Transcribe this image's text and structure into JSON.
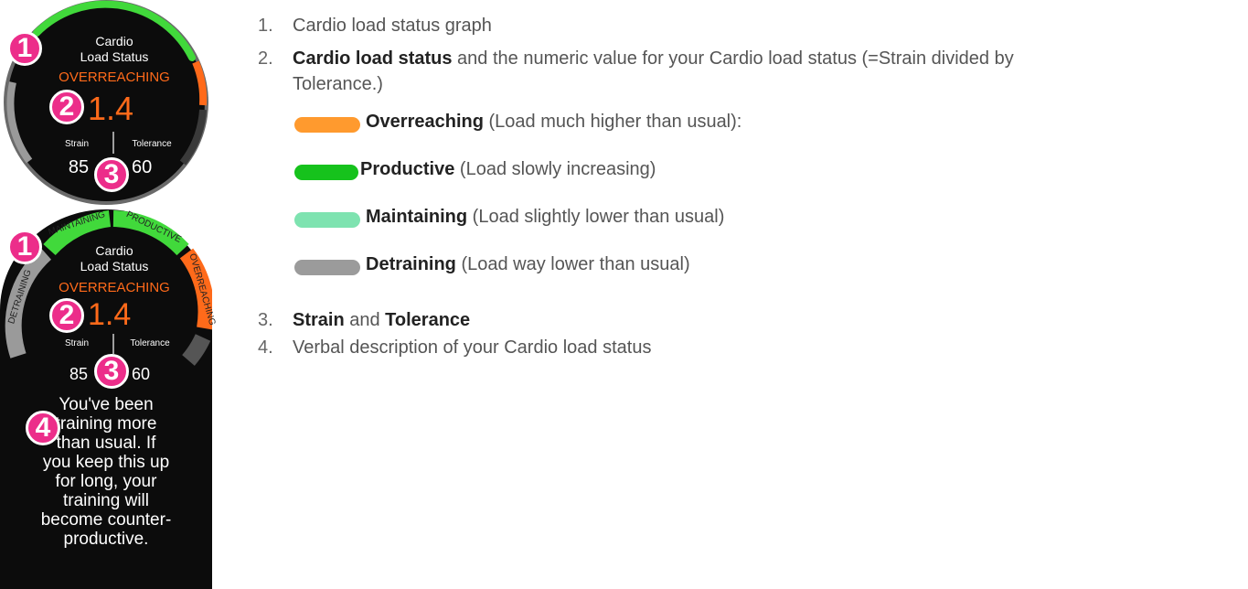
{
  "watch1": {
    "title_line1": "Cardio",
    "title_line2": "Load Status",
    "status": "OVERREACHING",
    "value": "1.4",
    "strain_label": "Strain",
    "tolerance_label": "Tolerance",
    "strain_value": "85",
    "tolerance_value": "60",
    "markers": [
      "1",
      "2",
      "3"
    ]
  },
  "watch2": {
    "title_line1": "Cardio",
    "title_line2": "Load Status",
    "status": "OVERREACHING",
    "value": "1.4",
    "strain_label": "Strain",
    "tolerance_label": "Tolerance",
    "strain_value": "85",
    "tolerance_value": "60",
    "arc_labels": {
      "detraining": "DETRAINING",
      "maintaining": "MAINTAINING",
      "productive": "PRODUCTIVE",
      "overreaching": "OVERREACHING"
    },
    "description_lines": [
      "You've been",
      "training more",
      "than usual. If",
      "you keep this up",
      "for long, your",
      "training will",
      "become counter-",
      "productive."
    ],
    "markers": [
      "1",
      "2",
      "3",
      "4"
    ]
  },
  "list": {
    "item1": {
      "num": "1.",
      "text": "Cardio load status graph"
    },
    "item2": {
      "num": "2.",
      "bold": "Cardio load status",
      "text_line1": " and the numeric value for your Cardio load status (=Strain divided by",
      "text_line2": "Tolerance.)"
    },
    "legend": [
      {
        "name": "Overreaching",
        "desc": " (Load much higher than usual):",
        "color": "#ff9a2e"
      },
      {
        "name": "Productive",
        "desc": " (Load slowly increasing)",
        "color": "#16c21c"
      },
      {
        "name": "Maintaining",
        "desc": " (Load slightly lower than usual)",
        "color": "#7ee3b0"
      },
      {
        "name": "Detraining",
        "desc": " (Load way lower than usual)",
        "color": "#9b9b9b"
      }
    ],
    "item3": {
      "num": "3.",
      "bold1": "Strain",
      "and": " and ",
      "bold2": "Tolerance"
    },
    "item4": {
      "num": "4.",
      "text": "Verbal description of your Cardio load status"
    }
  },
  "colors": {
    "accent_orange": "#ff6a1a",
    "marker_pink": "#ec2d8a",
    "arc_green": "#41d93b",
    "arc_grey": "#8c8c8c"
  }
}
